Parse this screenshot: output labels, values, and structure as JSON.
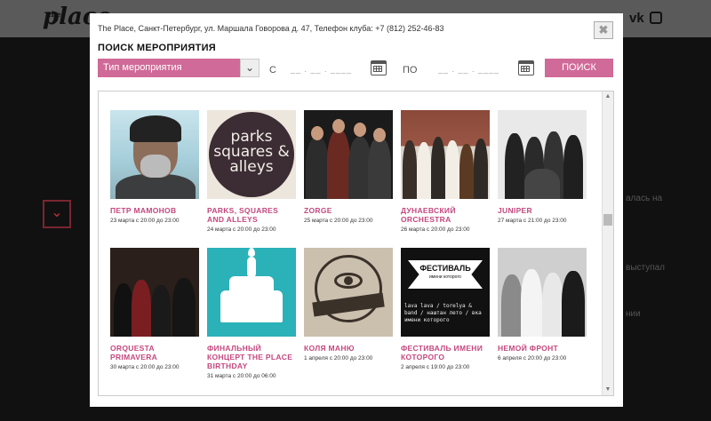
{
  "site": {
    "logo_small": "the",
    "logo": "place",
    "logo_url": "www.theplace",
    "social_vk": "vk",
    "side_text_1": "алась на",
    "side_text_2": "выступал",
    "side_text_3": "нии"
  },
  "modal": {
    "info": "The Place, Санкт-Петербург, ул. Маршала Говорова д. 47, Телефон клуба: +7 (812) 252-46-83",
    "title": "ПОИСК МЕРОПРИЯТИЯ",
    "close_label": "✖",
    "type_select_value": "Тип мероприятия",
    "from_label": "С",
    "to_label": "ПО",
    "date_placeholder": "__ . __ . ____",
    "search_label": "ПОИСК"
  },
  "events": [
    {
      "name": "ПЕТР МАМОНОВ",
      "time": "23 марта с 20:00 до 23:00"
    },
    {
      "name": "PARKS, SQUARES AND ALLEYS",
      "time": "24 марта с 20:00 до 23:00",
      "image_text": "parks squares & alleys"
    },
    {
      "name": "ZORGE",
      "time": "25 марта с 20:00 до 23:00"
    },
    {
      "name": "ДУНАЕВСКИЙ ORCHESTRA",
      "time": "26 марта с 20:00 до 23:00"
    },
    {
      "name": "JUNIPER",
      "time": "27 марта с 21:00 до 23:00"
    },
    {
      "name": "ORQUESTA PRIMAVERA",
      "time": "30 марта с 20:00 до 23:00"
    },
    {
      "name": "ФИНАЛЬНЫЙ КОНЦЕРТ THE PLACE BIRTHDAY",
      "time": "31 марта с 20:00 до 06:00"
    },
    {
      "name": "КОЛЯ МАНЮ",
      "time": "1 апреля с 20:00 до 23:00"
    },
    {
      "name": "ФЕСТИВАЛЬ ИМЕНИ КОТОРОГО",
      "time": "2 апреля с 19:00 до 23:00",
      "image_title": "ФЕСТИВАЛЬ",
      "image_sub": "имени которого",
      "image_lines": "lava lava / torelya & band / наштан лето / вка имени которого"
    },
    {
      "name": "НЕМОЙ ФРОНТ",
      "time": "6 апреля с 20:00 до 23:00"
    }
  ],
  "colors": {
    "accent": "#d06a98",
    "event_name": "#c4487f",
    "overlay_bg": "#111111"
  }
}
